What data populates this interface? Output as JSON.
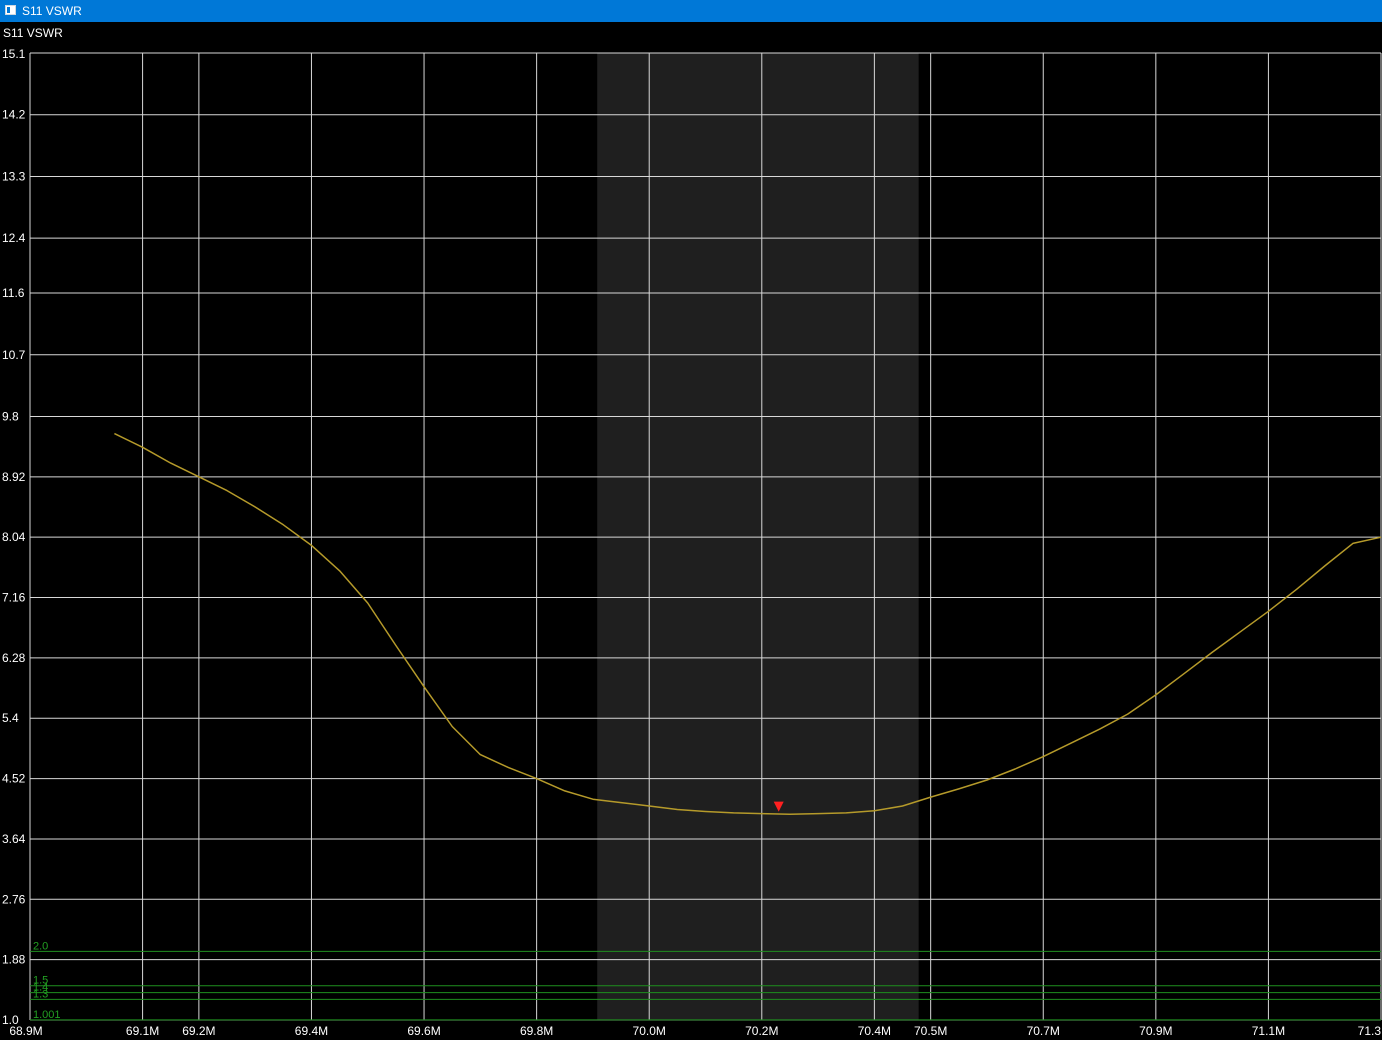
{
  "window": {
    "title": "S11 VSWR",
    "titlebar_color": "#0078d7"
  },
  "chart_data": {
    "type": "line",
    "title": "S11 VSWR",
    "xlabel": "",
    "ylabel": "",
    "xlim": [
      68.9,
      71.3
    ],
    "ylim": [
      1.0,
      15.1
    ],
    "x_tick_labels": [
      "68.9M",
      "69.1M",
      "69.2M",
      "69.4M",
      "69.6M",
      "69.8M",
      "70.0M",
      "70.2M",
      "70.4M",
      "70.5M",
      "70.7M",
      "70.9M",
      "71.1M",
      "71.3"
    ],
    "x_ticks": [
      68.9,
      69.1,
      69.2,
      69.4,
      69.6,
      69.8,
      70.0,
      70.2,
      70.4,
      70.5,
      70.7,
      70.9,
      71.1,
      71.3
    ],
    "y_tick_labels": [
      "15.1",
      "14.2",
      "13.3",
      "12.4",
      "11.6",
      "10.7",
      "9.8",
      "8.92",
      "8.04",
      "7.16",
      "6.28",
      "5.4",
      "4.52",
      "3.64",
      "2.76",
      "1.88",
      "1.0"
    ],
    "y_ticks": [
      15.1,
      14.2,
      13.3,
      12.4,
      11.6,
      10.7,
      9.8,
      8.92,
      8.04,
      7.16,
      6.28,
      5.4,
      4.52,
      3.64,
      2.76,
      1.88,
      1.0
    ],
    "grid": true,
    "highlight_band": [
      70.0,
      70.5
    ],
    "reference_lines": [
      {
        "label": "2.0",
        "value": 2.0
      },
      {
        "label": "1.5",
        "value": 1.5
      },
      {
        "label": "1.4",
        "value": 1.4
      },
      {
        "label": "1.3",
        "value": 1.3
      },
      {
        "label": "1.001",
        "value": 1.001
      }
    ],
    "series": [
      {
        "color": "#b59a2a",
        "x": [
          69.05,
          69.1,
          69.15,
          69.2,
          69.25,
          69.3,
          69.35,
          69.4,
          69.45,
          69.5,
          69.55,
          69.6,
          69.65,
          69.7,
          69.75,
          69.8,
          69.85,
          69.9,
          69.95,
          70.0,
          70.05,
          70.1,
          70.15,
          70.2,
          70.25,
          70.3,
          70.35,
          70.4,
          70.45,
          70.5,
          70.55,
          70.6,
          70.65,
          70.7,
          70.75,
          70.8,
          70.85,
          70.9,
          70.95,
          71.0,
          71.05,
          71.1,
          71.15,
          71.2,
          71.25,
          71.3
        ],
        "values": [
          9.55,
          9.35,
          9.12,
          8.92,
          8.72,
          8.48,
          8.22,
          7.92,
          7.55,
          7.08,
          6.46,
          5.86,
          5.28,
          4.87,
          4.68,
          4.52,
          4.34,
          4.22,
          4.17,
          4.12,
          4.07,
          4.04,
          4.02,
          4.01,
          4.0,
          4.01,
          4.02,
          4.05,
          4.12,
          4.25,
          4.37,
          4.5,
          4.66,
          4.84,
          5.04,
          5.24,
          5.46,
          5.74,
          6.05,
          6.36,
          6.66,
          6.96,
          7.28,
          7.62,
          7.95,
          8.04
        ]
      }
    ],
    "marker": {
      "x": 70.23,
      "y": 4.01,
      "color": "#ff2020"
    }
  }
}
